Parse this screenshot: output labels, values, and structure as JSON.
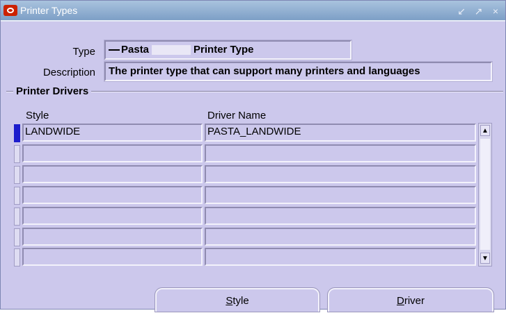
{
  "window": {
    "title": "Printer Types",
    "controls": [
      "↙",
      "↗",
      "×"
    ]
  },
  "form": {
    "type_label": "Type",
    "type_value_prefix": "Pasta",
    "type_value_suffix": "Printer Type",
    "description_label": "Description",
    "description_value": "The printer type that can support many printers and languages"
  },
  "drivers": {
    "section_title": "Printer Drivers",
    "columns": {
      "style": "Style",
      "driver_name": "Driver Name"
    },
    "rows": [
      {
        "style": "LANDWIDE",
        "driver_name": "PASTA_LANDWIDE",
        "active": true
      },
      {
        "style": "",
        "driver_name": "",
        "active": false
      },
      {
        "style": "",
        "driver_name": "",
        "active": false
      },
      {
        "style": "",
        "driver_name": "",
        "active": false
      },
      {
        "style": "",
        "driver_name": "",
        "active": false
      },
      {
        "style": "",
        "driver_name": "",
        "active": false
      },
      {
        "style": "",
        "driver_name": "",
        "active": false
      }
    ]
  },
  "buttons": {
    "style_first": "S",
    "style_rest": "tyle",
    "driver_first": "D",
    "driver_rest": "river"
  },
  "colors": {
    "background": "#ccc8ec",
    "titlebar": "#8fadd2",
    "active_row_indicator": "#1c1ccc",
    "logo": "#cc2200"
  }
}
